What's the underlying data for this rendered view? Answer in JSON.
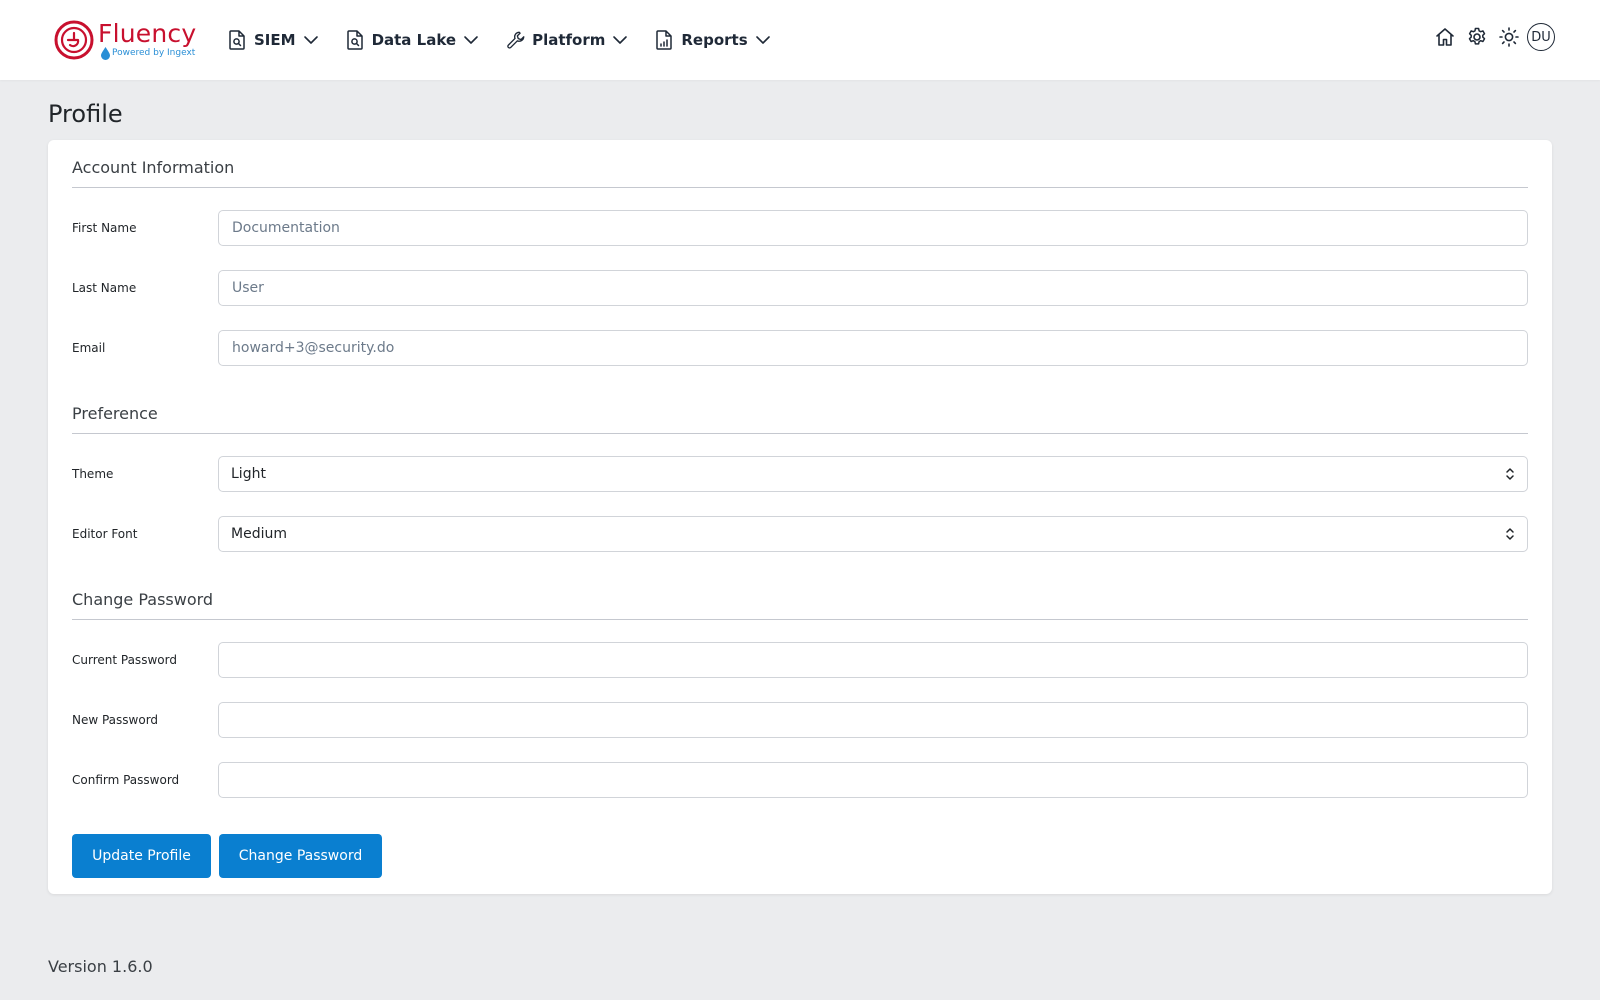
{
  "brand": {
    "name": "Fluency",
    "tagline": "Powered by Ingext",
    "primary_color": "#c8102e",
    "accent_color": "#2a8fd6"
  },
  "nav": {
    "items": [
      {
        "label": "SIEM",
        "icon": "document-search-icon"
      },
      {
        "label": "Data Lake",
        "icon": "document-search-icon"
      },
      {
        "label": "Platform",
        "icon": "wrench-icon"
      },
      {
        "label": "Reports",
        "icon": "document-chart-icon"
      }
    ]
  },
  "toolbar": {
    "icons": [
      "home-icon",
      "gear-icon",
      "sun-icon"
    ],
    "avatar_initials": "DU"
  },
  "page": {
    "title": "Profile"
  },
  "account": {
    "section_title": "Account Information",
    "first_name_label": "First Name",
    "first_name_value": "Documentation",
    "last_name_label": "Last Name",
    "last_name_value": "User",
    "email_label": "Email",
    "email_value": "howard+3@security.do"
  },
  "preference": {
    "section_title": "Preference",
    "theme_label": "Theme",
    "theme_value": "Light",
    "editor_font_label": "Editor Font",
    "editor_font_value": "Medium"
  },
  "password": {
    "section_title": "Change Password",
    "current_label": "Current Password",
    "new_label": "New Password",
    "confirm_label": "Confirm Password"
  },
  "actions": {
    "update_profile_label": "Update Profile",
    "change_password_label": "Change Password",
    "button_color": "#0a7fd0"
  },
  "footer": {
    "version": "Version 1.6.0"
  }
}
